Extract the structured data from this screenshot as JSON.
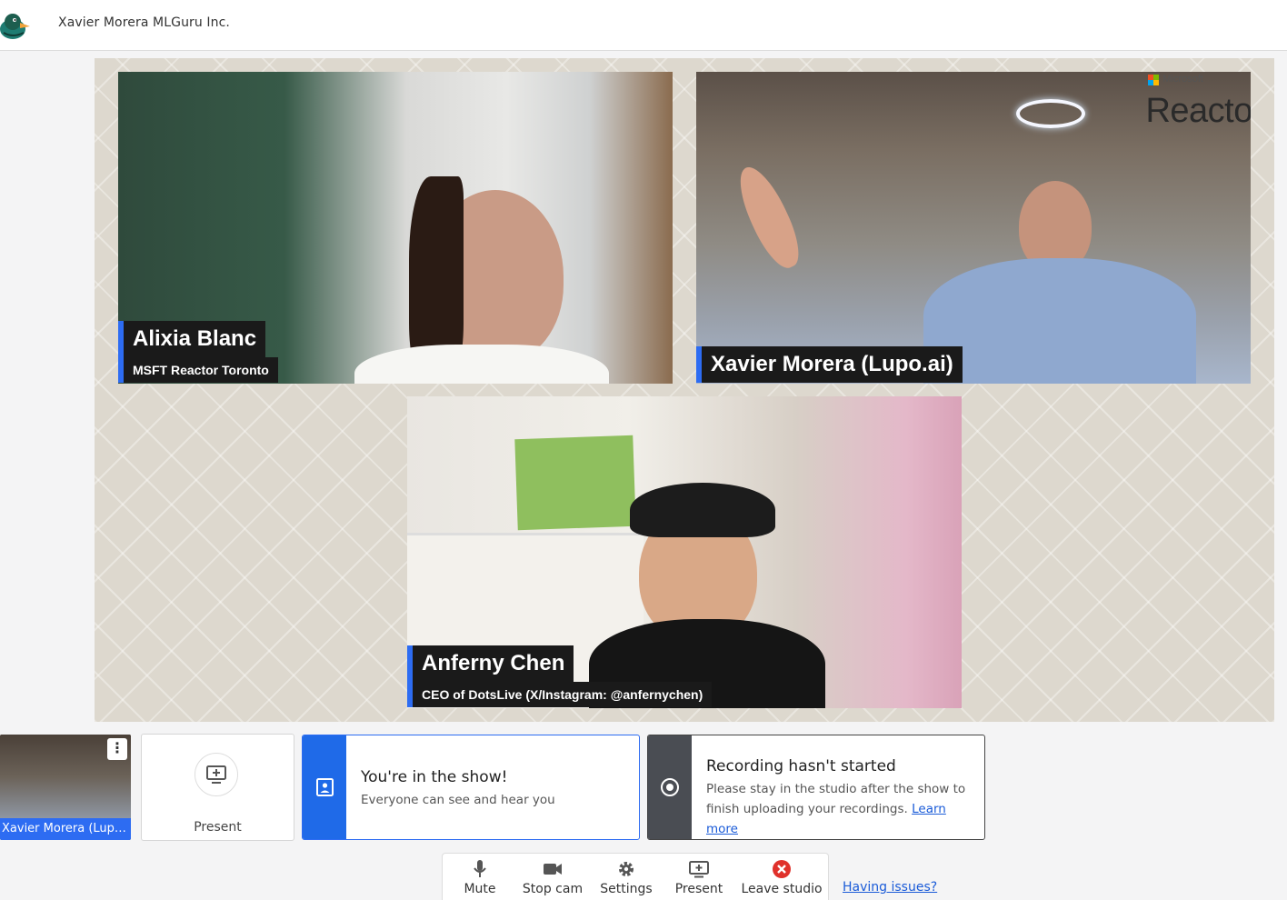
{
  "header": {
    "brand": "Xavier Morera MLGuru Inc."
  },
  "stage": {
    "tiles": [
      {
        "name": "Alixia Blanc",
        "subtitle": "MSFT Reactor Toronto"
      },
      {
        "name": "Xavier Morera (Lupo.ai)",
        "overlay_small": "Microsoft",
        "overlay_logo": "Reactor"
      },
      {
        "name": "Anferny Chen",
        "subtitle": "CEO of DotsLive (X/Instagram: @anfernychen)"
      }
    ]
  },
  "self_preview": {
    "label": "Xavier Morera (Lupo.ai)",
    "menu_glyph": "⋮"
  },
  "present_card": {
    "label": "Present"
  },
  "show_card": {
    "title": "You're in the show!",
    "body": "Everyone can see and hear you"
  },
  "recording_card": {
    "title": "Recording hasn't started",
    "body": "Please stay in the studio after the show to finish uploading your recordings.",
    "link": "Learn more"
  },
  "toolbar": {
    "buttons": [
      {
        "label": "Mute",
        "icon": "microphone-icon"
      },
      {
        "label": "Stop cam",
        "icon": "camera-icon"
      },
      {
        "label": "Settings",
        "icon": "gear-icon"
      },
      {
        "label": "Present",
        "icon": "screen-share-icon"
      },
      {
        "label": "Leave studio",
        "icon": "leave-icon"
      }
    ],
    "help_link": "Having issues?"
  },
  "colors": {
    "accent": "#2d6cf2",
    "leave": "#e0312b",
    "record_side": "#4a4d53"
  }
}
